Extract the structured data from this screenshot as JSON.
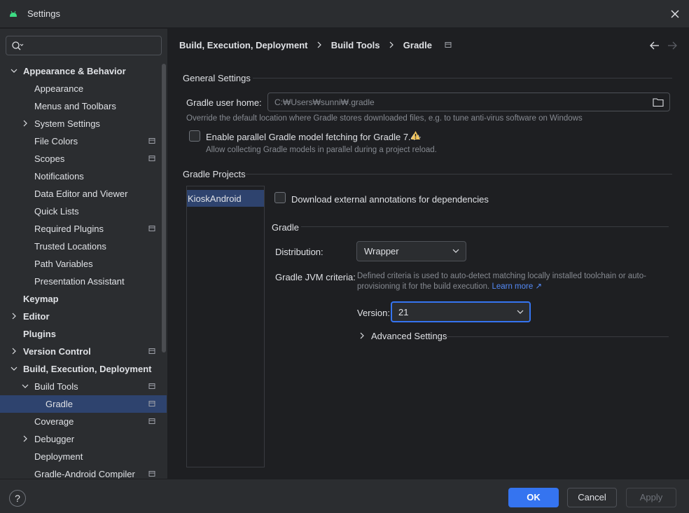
{
  "window": {
    "title": "Settings"
  },
  "search": {
    "placeholder": "",
    "value": ""
  },
  "tree": {
    "items": [
      {
        "label": "Appearance & Behavior",
        "level": 0,
        "bold": true,
        "expander": "expanded",
        "project_icon": false,
        "selected": false
      },
      {
        "label": "Appearance",
        "level": 1,
        "bold": false,
        "expander": "none",
        "project_icon": false,
        "selected": false
      },
      {
        "label": "Menus and Toolbars",
        "level": 1,
        "bold": false,
        "expander": "none",
        "project_icon": false,
        "selected": false
      },
      {
        "label": "System Settings",
        "level": 1,
        "bold": false,
        "expander": "collapsed",
        "project_icon": false,
        "selected": false
      },
      {
        "label": "File Colors",
        "level": 1,
        "bold": false,
        "expander": "none",
        "project_icon": true,
        "selected": false
      },
      {
        "label": "Scopes",
        "level": 1,
        "bold": false,
        "expander": "none",
        "project_icon": true,
        "selected": false
      },
      {
        "label": "Notifications",
        "level": 1,
        "bold": false,
        "expander": "none",
        "project_icon": false,
        "selected": false
      },
      {
        "label": "Data Editor and Viewer",
        "level": 1,
        "bold": false,
        "expander": "none",
        "project_icon": false,
        "selected": false
      },
      {
        "label": "Quick Lists",
        "level": 1,
        "bold": false,
        "expander": "none",
        "project_icon": false,
        "selected": false
      },
      {
        "label": "Required Plugins",
        "level": 1,
        "bold": false,
        "expander": "none",
        "project_icon": true,
        "selected": false
      },
      {
        "label": "Trusted Locations",
        "level": 1,
        "bold": false,
        "expander": "none",
        "project_icon": false,
        "selected": false
      },
      {
        "label": "Path Variables",
        "level": 1,
        "bold": false,
        "expander": "none",
        "project_icon": false,
        "selected": false
      },
      {
        "label": "Presentation Assistant",
        "level": 1,
        "bold": false,
        "expander": "none",
        "project_icon": false,
        "selected": false
      },
      {
        "label": "Keymap",
        "level": 0,
        "bold": true,
        "expander": "none",
        "project_icon": false,
        "selected": false
      },
      {
        "label": "Editor",
        "level": 0,
        "bold": true,
        "expander": "collapsed",
        "project_icon": false,
        "selected": false
      },
      {
        "label": "Plugins",
        "level": 0,
        "bold": true,
        "expander": "none",
        "project_icon": false,
        "selected": false
      },
      {
        "label": "Version Control",
        "level": 0,
        "bold": true,
        "expander": "collapsed",
        "project_icon": true,
        "selected": false
      },
      {
        "label": "Build, Execution, Deployment",
        "level": 0,
        "bold": true,
        "expander": "expanded",
        "project_icon": false,
        "selected": false
      },
      {
        "label": "Build Tools",
        "level": 1,
        "bold": false,
        "expander": "expanded",
        "project_icon": true,
        "selected": false
      },
      {
        "label": "Gradle",
        "level": 2,
        "bold": false,
        "expander": "none",
        "project_icon": true,
        "selected": true
      },
      {
        "label": "Coverage",
        "level": 1,
        "bold": false,
        "expander": "none",
        "project_icon": true,
        "selected": false
      },
      {
        "label": "Debugger",
        "level": 1,
        "bold": false,
        "expander": "collapsed",
        "project_icon": false,
        "selected": false
      },
      {
        "label": "Deployment",
        "level": 1,
        "bold": false,
        "expander": "none",
        "project_icon": false,
        "selected": false
      },
      {
        "label": "Gradle-Android Compiler",
        "level": 1,
        "bold": false,
        "expander": "none",
        "project_icon": true,
        "selected": false
      }
    ]
  },
  "breadcrumb": [
    "Build, Execution, Deployment",
    "Build Tools",
    "Gradle"
  ],
  "general_settings": {
    "title": "General Settings",
    "gradle_home_label": "Gradle user home:",
    "gradle_home_value": "C:₩Users₩sunni₩.gradle",
    "gradle_home_hint": "Override the default location where Gradle stores downloaded files, e.g. to tune anti-virus software on Windows",
    "parallel_label": "Enable parallel Gradle model fetching for Gradle 7.4+",
    "parallel_hint": "Allow collecting Gradle models in parallel during a project reload."
  },
  "gradle_projects": {
    "title": "Gradle Projects",
    "projects": [
      "KioskAndroid"
    ],
    "download_annotations_label": "Download external annotations for dependencies",
    "gradle_section_title": "Gradle",
    "distribution_label": "Distribution:",
    "distribution_value": "Wrapper",
    "jvm_criteria_label": "Gradle JVM criteria:",
    "jvm_criteria_text": "Defined criteria is used to auto-detect matching locally installed toolchain or auto-provisioning it for the build execution.",
    "learn_more": "Learn more ↗",
    "version_label": "Version:",
    "version_value": "21",
    "advanced_settings": "Advanced Settings"
  },
  "footer": {
    "help": "?",
    "ok": "OK",
    "cancel": "Cancel",
    "apply": "Apply"
  },
  "colors": {
    "background": "#1e1f22",
    "panel": "#2b2d30",
    "accent": "#3574f0",
    "selection": "#2e436e",
    "link": "#548af7",
    "warning": "#f2c55c"
  }
}
